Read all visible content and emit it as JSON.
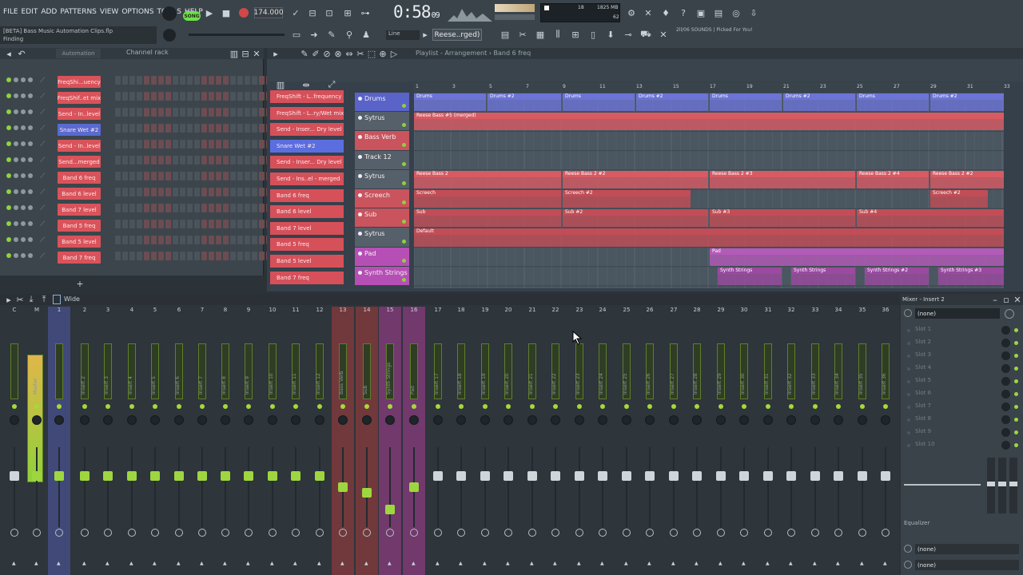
{
  "menu": [
    "FILE",
    "EDIT",
    "ADD",
    "PATTERNS",
    "VIEW",
    "OPTIONS",
    "TOOLS",
    "HELP"
  ],
  "transport": {
    "song_badge": "SONG",
    "tempo": "174.000",
    "time_main": "0:58",
    "time_sub": "09"
  },
  "cpu": {
    "top": "18",
    "ram": "1825 MB",
    "bottom": "62"
  },
  "hint": {
    "project": "[BETA] Bass Music Automation Clips.flp",
    "status": "Finding"
  },
  "toolbar": {
    "snap": "Line",
    "preset": "Reese..rged)",
    "sounds": "2ll/06  SOUNDS | Picked For You!"
  },
  "rack": {
    "title": "Channel rack",
    "filter": "Automation",
    "channels": [
      {
        "name": "FreqShi...uency",
        "sel": false
      },
      {
        "name": "FreqShif..et mix",
        "sel": false
      },
      {
        "name": "Send - In..level",
        "sel": false
      },
      {
        "name": "Snare Wet #2",
        "sel": true
      },
      {
        "name": "Send - In..level",
        "sel": false
      },
      {
        "name": "Send...merged",
        "sel": false
      },
      {
        "name": "Band 6 freq",
        "sel": false
      },
      {
        "name": "Band 6 level",
        "sel": false
      },
      {
        "name": "Band 7 level",
        "sel": false
      },
      {
        "name": "Band 5 freq",
        "sel": false
      },
      {
        "name": "Band 5 level",
        "sel": false
      },
      {
        "name": "Band 7 freq",
        "sel": false
      }
    ]
  },
  "playlist": {
    "breadcrumb": "Playlist - Arrangement › Band 6 freq",
    "picker": [
      {
        "name": "FreqShift - L..frequency",
        "sel": false
      },
      {
        "name": "FreqShift - L..ry/Wet mix",
        "sel": false
      },
      {
        "name": "Send - Inser... Dry level",
        "sel": false
      },
      {
        "name": "Snare Wet #2",
        "sel": true
      },
      {
        "name": "Send - Inser... Dry level",
        "sel": false
      },
      {
        "name": "Send - Ins..el - merged",
        "sel": false
      },
      {
        "name": "Band 6 freq",
        "sel": false
      },
      {
        "name": "Band 6 level",
        "sel": false
      },
      {
        "name": "Band 7 level",
        "sel": false
      },
      {
        "name": "Band 5 freq",
        "sel": false
      },
      {
        "name": "Band 5 level",
        "sel": false
      },
      {
        "name": "Band 7 freq",
        "sel": false
      }
    ],
    "ruler": [
      "1",
      "3",
      "5",
      "7",
      "9",
      "11",
      "13",
      "15",
      "17",
      "19",
      "21",
      "23",
      "25",
      "27",
      "29",
      "31",
      "33"
    ],
    "tracks": [
      {
        "name": "Drums",
        "color": "#5a63c8",
        "h": 24
      },
      {
        "name": "Sytrus",
        "color": "#56606a",
        "h": 24
      },
      {
        "name": "Bass Verb",
        "color": "#c9545e",
        "h": 24
      },
      {
        "name": "Track 12",
        "color": "#56606a",
        "h": 24
      },
      {
        "name": "Sytrus",
        "color": "#56606a",
        "h": 24
      },
      {
        "name": "Screech",
        "color": "#c9545e",
        "h": 24
      },
      {
        "name": "Sub",
        "color": "#c9545e",
        "h": 24
      },
      {
        "name": "Sytrus",
        "color": "#56606a",
        "h": 24
      },
      {
        "name": "Pad",
        "color": "#b64fb5",
        "h": 24
      },
      {
        "name": "Synth Strings",
        "color": "#b64fb5",
        "h": 24
      }
    ],
    "clips": [
      {
        "row": 0,
        "from": 0,
        "to": 90,
        "name": "Drums",
        "color": "#6c74d6"
      },
      {
        "row": 0,
        "from": 92,
        "to": 184,
        "name": "Drums #2",
        "color": "#6c74d6"
      },
      {
        "row": 0,
        "from": 186,
        "to": 276,
        "name": "Drums",
        "color": "#6c74d6"
      },
      {
        "row": 0,
        "from": 278,
        "to": 368,
        "name": "Drums #2",
        "color": "#6c74d6"
      },
      {
        "row": 0,
        "from": 370,
        "to": 460,
        "name": "Drums",
        "color": "#6c74d6"
      },
      {
        "row": 0,
        "from": 462,
        "to": 552,
        "name": "Drums #2",
        "color": "#6c74d6"
      },
      {
        "row": 0,
        "from": 554,
        "to": 644,
        "name": "Drums",
        "color": "#6c74d6"
      },
      {
        "row": 0,
        "from": 646,
        "to": 738,
        "name": "Drums #2",
        "color": "#6c74d6"
      },
      {
        "row": 1,
        "from": 0,
        "to": 738,
        "name": "Reese Bass #5 (merged)",
        "color": "#d85a63"
      },
      {
        "row": 4,
        "from": 0,
        "to": 184,
        "name": "Reese Bass 2",
        "color": "#d85a63"
      },
      {
        "row": 4,
        "from": 186,
        "to": 368,
        "name": "Reese Bass 2 #2",
        "color": "#d85a63"
      },
      {
        "row": 4,
        "from": 370,
        "to": 552,
        "name": "Reese Bass 2 #3",
        "color": "#d85a63"
      },
      {
        "row": 4,
        "from": 554,
        "to": 644,
        "name": "Reese Bass 2 #4",
        "color": "#d85a63"
      },
      {
        "row": 4,
        "from": 646,
        "to": 738,
        "name": "Reese Bass 2 #2",
        "color": "#d85a63"
      },
      {
        "row": 5,
        "from": 0,
        "to": 184,
        "name": "Screech",
        "color": "#c24d56"
      },
      {
        "row": 5,
        "from": 186,
        "to": 346,
        "name": "Screech #2",
        "color": "#c24d56"
      },
      {
        "row": 5,
        "from": 646,
        "to": 718,
        "name": "Screech #2",
        "color": "#c24d56"
      },
      {
        "row": 6,
        "from": 0,
        "to": 184,
        "name": "Sub",
        "color": "#c24d56"
      },
      {
        "row": 6,
        "from": 186,
        "to": 368,
        "name": "Sub #2",
        "color": "#c24d56"
      },
      {
        "row": 6,
        "from": 370,
        "to": 552,
        "name": "Sub #3",
        "color": "#c24d56"
      },
      {
        "row": 6,
        "from": 554,
        "to": 738,
        "name": "Sub #4",
        "color": "#c24d56"
      },
      {
        "row": 7,
        "from": 0,
        "to": 738,
        "name": "Default",
        "color": "#c24d56"
      },
      {
        "row": 8,
        "from": 370,
        "to": 738,
        "name": "Pad",
        "color": "#b45ab8"
      },
      {
        "row": 9,
        "from": 380,
        "to": 460,
        "name": "Synth Strings",
        "color": "#9b4aa0"
      },
      {
        "row": 9,
        "from": 472,
        "to": 552,
        "name": "Synth Strings",
        "color": "#9b4aa0"
      },
      {
        "row": 9,
        "from": 564,
        "to": 644,
        "name": "Synth Strings #2",
        "color": "#9b4aa0"
      },
      {
        "row": 9,
        "from": 656,
        "to": 738,
        "name": "Synth Strings #3",
        "color": "#9b4aa0"
      }
    ]
  },
  "mixer": {
    "title": "Wide",
    "strips": [
      {
        "num": "C",
        "label": "",
        "hl": ""
      },
      {
        "num": "M",
        "label": "Master",
        "hl": ""
      },
      {
        "num": "1",
        "label": "",
        "hl": "blue"
      },
      {
        "num": "2",
        "label": "Insert 2",
        "hl": ""
      },
      {
        "num": "3",
        "label": "Insert 3",
        "hl": ""
      },
      {
        "num": "4",
        "label": "Insert 4",
        "hl": ""
      },
      {
        "num": "5",
        "label": "Insert 5",
        "hl": ""
      },
      {
        "num": "6",
        "label": "Insert 6",
        "hl": ""
      },
      {
        "num": "7",
        "label": "Insert 7",
        "hl": ""
      },
      {
        "num": "8",
        "label": "Insert 8",
        "hl": ""
      },
      {
        "num": "9",
        "label": "Insert 9",
        "hl": ""
      },
      {
        "num": "10",
        "label": "Insert 10",
        "hl": ""
      },
      {
        "num": "11",
        "label": "Insert 11",
        "hl": ""
      },
      {
        "num": "12",
        "label": "Insert 12",
        "hl": ""
      },
      {
        "num": "13",
        "label": "Bass Verb",
        "hl": "red"
      },
      {
        "num": "14",
        "label": "Sub",
        "hl": "red"
      },
      {
        "num": "15",
        "label": "Synth Strings",
        "hl": "pink"
      },
      {
        "num": "16",
        "label": "Pad",
        "hl": "pink"
      },
      {
        "num": "17",
        "label": "Insert 17",
        "hl": ""
      },
      {
        "num": "18",
        "label": "Insert 18",
        "hl": ""
      },
      {
        "num": "19",
        "label": "Insert 19",
        "hl": ""
      },
      {
        "num": "20",
        "label": "Insert 20",
        "hl": ""
      },
      {
        "num": "21",
        "label": "Insert 21",
        "hl": ""
      },
      {
        "num": "22",
        "label": "Insert 22",
        "hl": ""
      },
      {
        "num": "23",
        "label": "Insert 23",
        "hl": ""
      },
      {
        "num": "24",
        "label": "Insert 24",
        "hl": ""
      },
      {
        "num": "25",
        "label": "Insert 25",
        "hl": ""
      },
      {
        "num": "26",
        "label": "Insert 26",
        "hl": ""
      },
      {
        "num": "27",
        "label": "Insert 27",
        "hl": ""
      },
      {
        "num": "28",
        "label": "Insert 28",
        "hl": ""
      },
      {
        "num": "29",
        "label": "Insert 29",
        "hl": ""
      },
      {
        "num": "30",
        "label": "Insert 30",
        "hl": ""
      },
      {
        "num": "31",
        "label": "Insert 31",
        "hl": ""
      },
      {
        "num": "32",
        "label": "Insert 32",
        "hl": ""
      },
      {
        "num": "33",
        "label": "Insert 33",
        "hl": ""
      },
      {
        "num": "34",
        "label": "Insert 34",
        "hl": ""
      },
      {
        "num": "35",
        "label": "Insert 35",
        "hl": ""
      },
      {
        "num": "36",
        "label": "Insert 36",
        "hl": ""
      }
    ],
    "faders": [
      0.7,
      0.7,
      0.7,
      0.7,
      0.7,
      0.7,
      0.7,
      0.7,
      0.7,
      0.7,
      0.7,
      0.7,
      0.7,
      0.7,
      0.56,
      0.49,
      0.28,
      0.56,
      0.7,
      0.7,
      0.7,
      0.7,
      0.7,
      0.7,
      0.7,
      0.7,
      0.7,
      0.7,
      0.7,
      0.7,
      0.7,
      0.7,
      0.7,
      0.7,
      0.7,
      0.7,
      0.7,
      0.7
    ]
  },
  "insert_panel": {
    "title": "Mixer - Insert 2",
    "input": "(none)",
    "slots": [
      "Slot 1",
      "Slot 2",
      "Slot 3",
      "Slot 4",
      "Slot 5",
      "Slot 6",
      "Slot 7",
      "Slot 8",
      "Slot 9",
      "Slot 10"
    ],
    "eq_label": "Equalizer",
    "out1": "(none)",
    "out2": "(none)"
  }
}
